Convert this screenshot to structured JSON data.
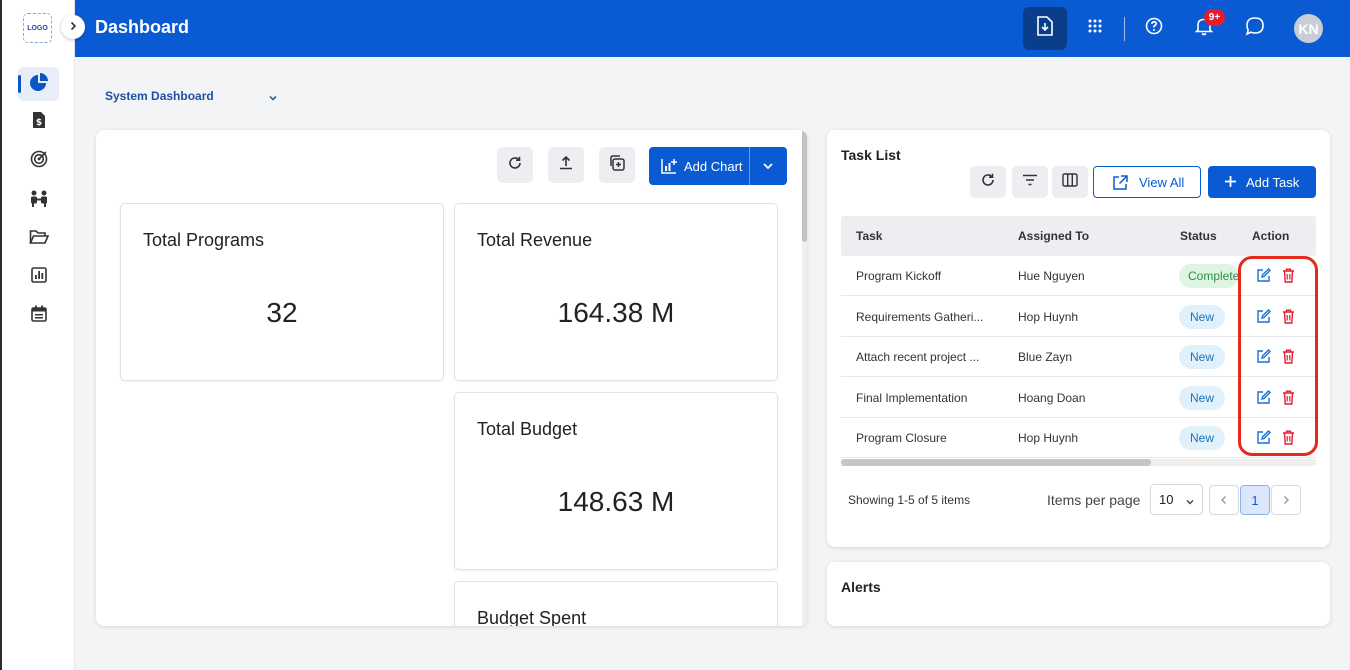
{
  "app": {
    "title": "Dashboard",
    "logo_text": "LOGO"
  },
  "header": {
    "notifications_badge": "9+",
    "avatar_initials": "KN",
    "icons": [
      "import-icon",
      "apps-grid-icon",
      "help-icon",
      "bell-icon",
      "chat-icon"
    ]
  },
  "sidebar": {
    "items": [
      {
        "name": "dashboard",
        "icon": "pie-chart-icon",
        "active": true
      },
      {
        "name": "finance",
        "icon": "dollar-document-icon",
        "active": false
      },
      {
        "name": "goals",
        "icon": "target-icon",
        "active": false
      },
      {
        "name": "team",
        "icon": "people-icon",
        "active": false
      },
      {
        "name": "folders",
        "icon": "folder-open-icon",
        "active": false
      },
      {
        "name": "reports",
        "icon": "bar-chart-icon",
        "active": false
      },
      {
        "name": "calendar",
        "icon": "calendar-icon",
        "active": false
      }
    ]
  },
  "dashboard_select": {
    "value": "System Dashboard"
  },
  "charts_panel": {
    "add_chart_label": "Add Chart",
    "cards": [
      {
        "title": "Total Programs",
        "value": "32"
      },
      {
        "title": "Total Revenue",
        "value": "164.38 M"
      },
      {
        "title": "Total Budget",
        "value": "148.63 M"
      },
      {
        "title": "Budget Spent",
        "value": ""
      }
    ]
  },
  "task_list": {
    "title": "Task List",
    "view_all_label": "View All",
    "add_task_label": "Add Task",
    "columns": [
      "Task",
      "Assigned To",
      "Status",
      "Action"
    ],
    "rows": [
      {
        "task": "Program Kickoff",
        "assigned": "Hue Nguyen",
        "status": "Completed",
        "status_kind": "done"
      },
      {
        "task": "Requirements Gatheri...",
        "assigned": "Hop Huynh",
        "status": "New",
        "status_kind": "new"
      },
      {
        "task": "Attach recent project ...",
        "assigned": "Blue Zayn",
        "status": "New",
        "status_kind": "new"
      },
      {
        "task": "Final Implementation",
        "assigned": "Hoang Doan",
        "status": "New",
        "status_kind": "new"
      },
      {
        "task": "Program Closure",
        "assigned": "Hop Huynh",
        "status": "New",
        "status_kind": "new"
      }
    ],
    "showing_text": "Showing 1-5 of 5 items",
    "items_per_page_label": "Items per page",
    "items_per_page_value": "10",
    "current_page": "1"
  },
  "alerts": {
    "title": "Alerts"
  },
  "colors": {
    "primary": "#0a5bd3",
    "header_dark": "#0b3e8a",
    "danger": "#e11d2e",
    "highlight": "#e5291a"
  }
}
